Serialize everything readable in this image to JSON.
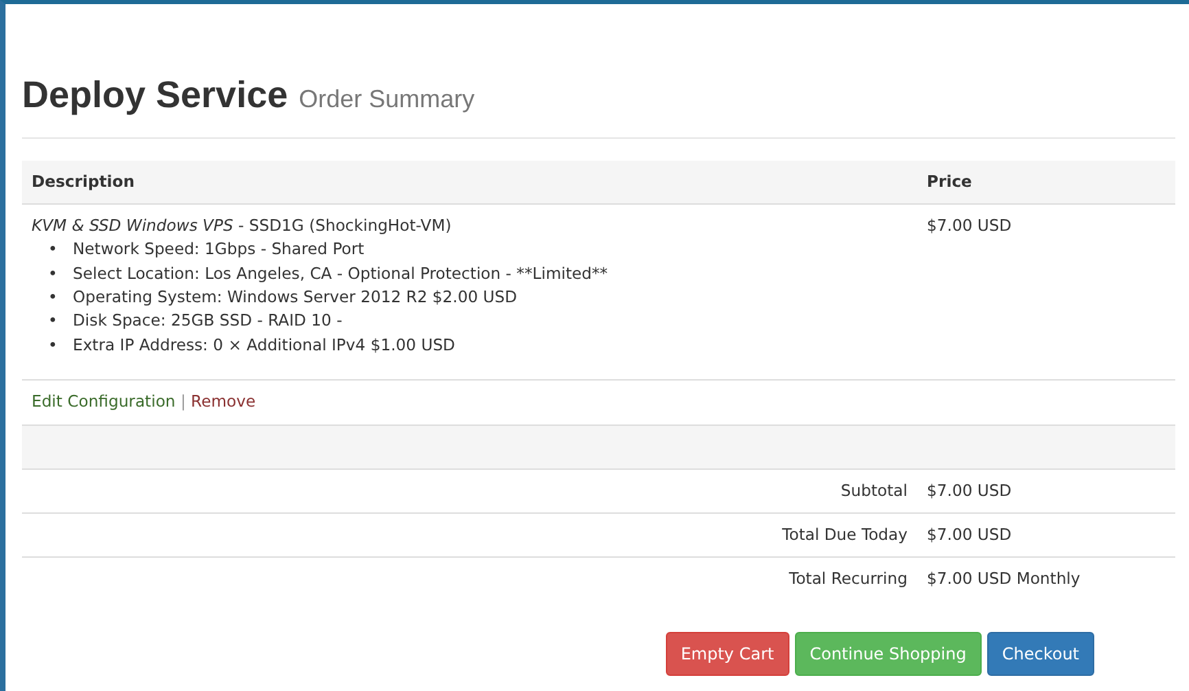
{
  "header": {
    "title": "Deploy Service",
    "subtitle": "Order Summary"
  },
  "table": {
    "columns": [
      "Description",
      "Price"
    ],
    "item": {
      "product": "KVM & SSD Windows VPS",
      "plan": " - SSD1G (ShockingHot-VM)",
      "price": "$7.00 USD",
      "bullet": "•",
      "options": [
        "Network Speed: 1Gbps - Shared Port",
        "Select Location: Los Angeles, CA - Optional Protection - **Limited**",
        "Operating System: Windows Server 2012 R2 $2.00 USD",
        "Disk Space: 25GB SSD - RAID 10 -",
        "Extra IP Address: 0 × Additional IPv4 $1.00 USD"
      ],
      "actions": [
        {
          "label": "Edit Configuration",
          "kind": "edit"
        },
        {
          "label": "Remove",
          "kind": "remove"
        }
      ],
      "separator": "|"
    },
    "totals": [
      {
        "label": "Subtotal",
        "value": "$7.00 USD"
      },
      {
        "label": "Total Due Today",
        "value": "$7.00 USD"
      },
      {
        "label": "Total Recurring",
        "value": "$7.00 USD Monthly"
      }
    ]
  },
  "buttons": [
    {
      "label": "Empty Cart",
      "kind": "danger"
    },
    {
      "label": "Continue Shopping",
      "kind": "success"
    },
    {
      "label": "Checkout",
      "kind": "primary"
    }
  ]
}
